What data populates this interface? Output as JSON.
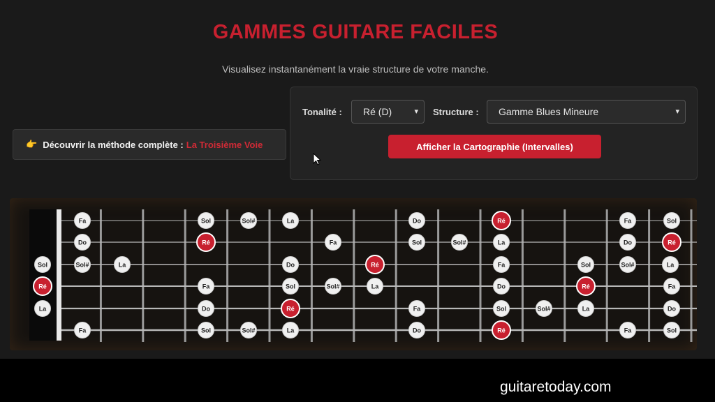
{
  "header": {
    "title": "GAMMES GUITARE FACILES",
    "subtitle": "Visualisez instantanément la vraie structure de votre manche."
  },
  "promo": {
    "icon": "pointing-hand-icon",
    "text": "Découvrir la méthode complète :",
    "link_text": "La Troisième Voie"
  },
  "controls": {
    "tonality_label": "Tonalité :",
    "tonality_value": "Ré (D)",
    "structure_label": "Structure :",
    "structure_value": "Gamme Blues Mineure",
    "submit_label": "Afficher la Cartographie (Intervalles)"
  },
  "fretboard": {
    "fret_count": 15,
    "root_color": "#c8202f",
    "note_color": "#f0f0f0",
    "strings": [
      [
        "",
        "Fa",
        "",
        "",
        "Sol",
        "Sol#",
        "La",
        "",
        "",
        "Do",
        "",
        "Ré",
        "",
        "",
        "Fa",
        "",
        "Sol"
      ],
      [
        "",
        "Do",
        "",
        "",
        "Ré",
        "",
        "",
        "Fa",
        "",
        "Sol",
        "Sol#",
        "La",
        "",
        "",
        "Do",
        "",
        "Ré"
      ],
      [
        "Sol",
        "Sol#",
        "La",
        "",
        "",
        "",
        "Do",
        "",
        "Ré",
        "",
        "",
        "Fa",
        "",
        "Sol",
        "Sol#",
        "La",
        ""
      ],
      [
        "Ré",
        "",
        "",
        "",
        "Fa",
        "",
        "Sol",
        "Sol#",
        "La",
        "",
        "",
        "Do",
        "",
        "Ré",
        "",
        "",
        "Fa"
      ],
      [
        "La",
        "",
        "",
        "",
        "Do",
        "",
        "Ré",
        "",
        "",
        "Fa",
        "",
        "Sol",
        "Sol#",
        "La",
        "",
        "",
        "Do"
      ],
      [
        "",
        "Fa",
        "",
        "",
        "Sol",
        "Sol#",
        "La",
        "",
        "",
        "Do",
        "",
        "Ré",
        "",
        "",
        "Fa",
        "",
        "Sol"
      ]
    ]
  },
  "watermark": "guitaretoday.com"
}
